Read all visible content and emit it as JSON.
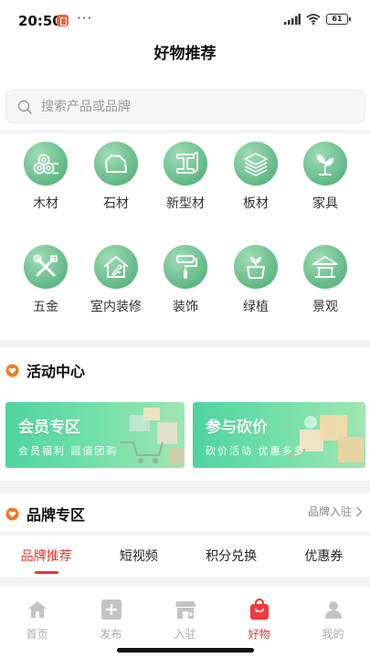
{
  "status": {
    "time": "20:50",
    "dots": "···",
    "battery": "61"
  },
  "header": {
    "title": "好物推荐"
  },
  "search": {
    "placeholder": "搜索产品或品牌"
  },
  "categories": [
    {
      "label": "木材",
      "icon": "wood-logs-icon"
    },
    {
      "label": "石材",
      "icon": "stone-icon"
    },
    {
      "label": "新型材",
      "icon": "steel-beam-icon"
    },
    {
      "label": "板材",
      "icon": "board-stack-icon"
    },
    {
      "label": "家具",
      "icon": "sprout-icon"
    },
    {
      "label": "五金",
      "icon": "tools-icon"
    },
    {
      "label": "室内装修",
      "icon": "house-brush-icon"
    },
    {
      "label": "装饰",
      "icon": "paint-roller-icon"
    },
    {
      "label": "绿植",
      "icon": "potted-plant-icon"
    },
    {
      "label": "景观",
      "icon": "pavilion-icon"
    }
  ],
  "activity": {
    "title": "活动中心",
    "banners": [
      {
        "title": "会员专区",
        "subtitle": "会员福利 超值团购"
      },
      {
        "title": "参与砍价",
        "subtitle": "砍价活动 优惠多多"
      }
    ]
  },
  "brand": {
    "title": "品牌专区",
    "link": "品牌入驻"
  },
  "tabs": [
    "品牌推荐",
    "短视频",
    "积分兑换",
    "优惠券"
  ],
  "tabbar": [
    {
      "label": "首页",
      "icon": "home-icon"
    },
    {
      "label": "发布",
      "icon": "publish-plus-icon"
    },
    {
      "label": "入驻",
      "icon": "storefront-icon"
    },
    {
      "label": "好物",
      "icon": "shopping-bag-icon"
    },
    {
      "label": "我的",
      "icon": "profile-icon"
    }
  ],
  "colors": {
    "accent": "#e53935",
    "green": "#62b987",
    "orange": "#f07a2a"
  }
}
